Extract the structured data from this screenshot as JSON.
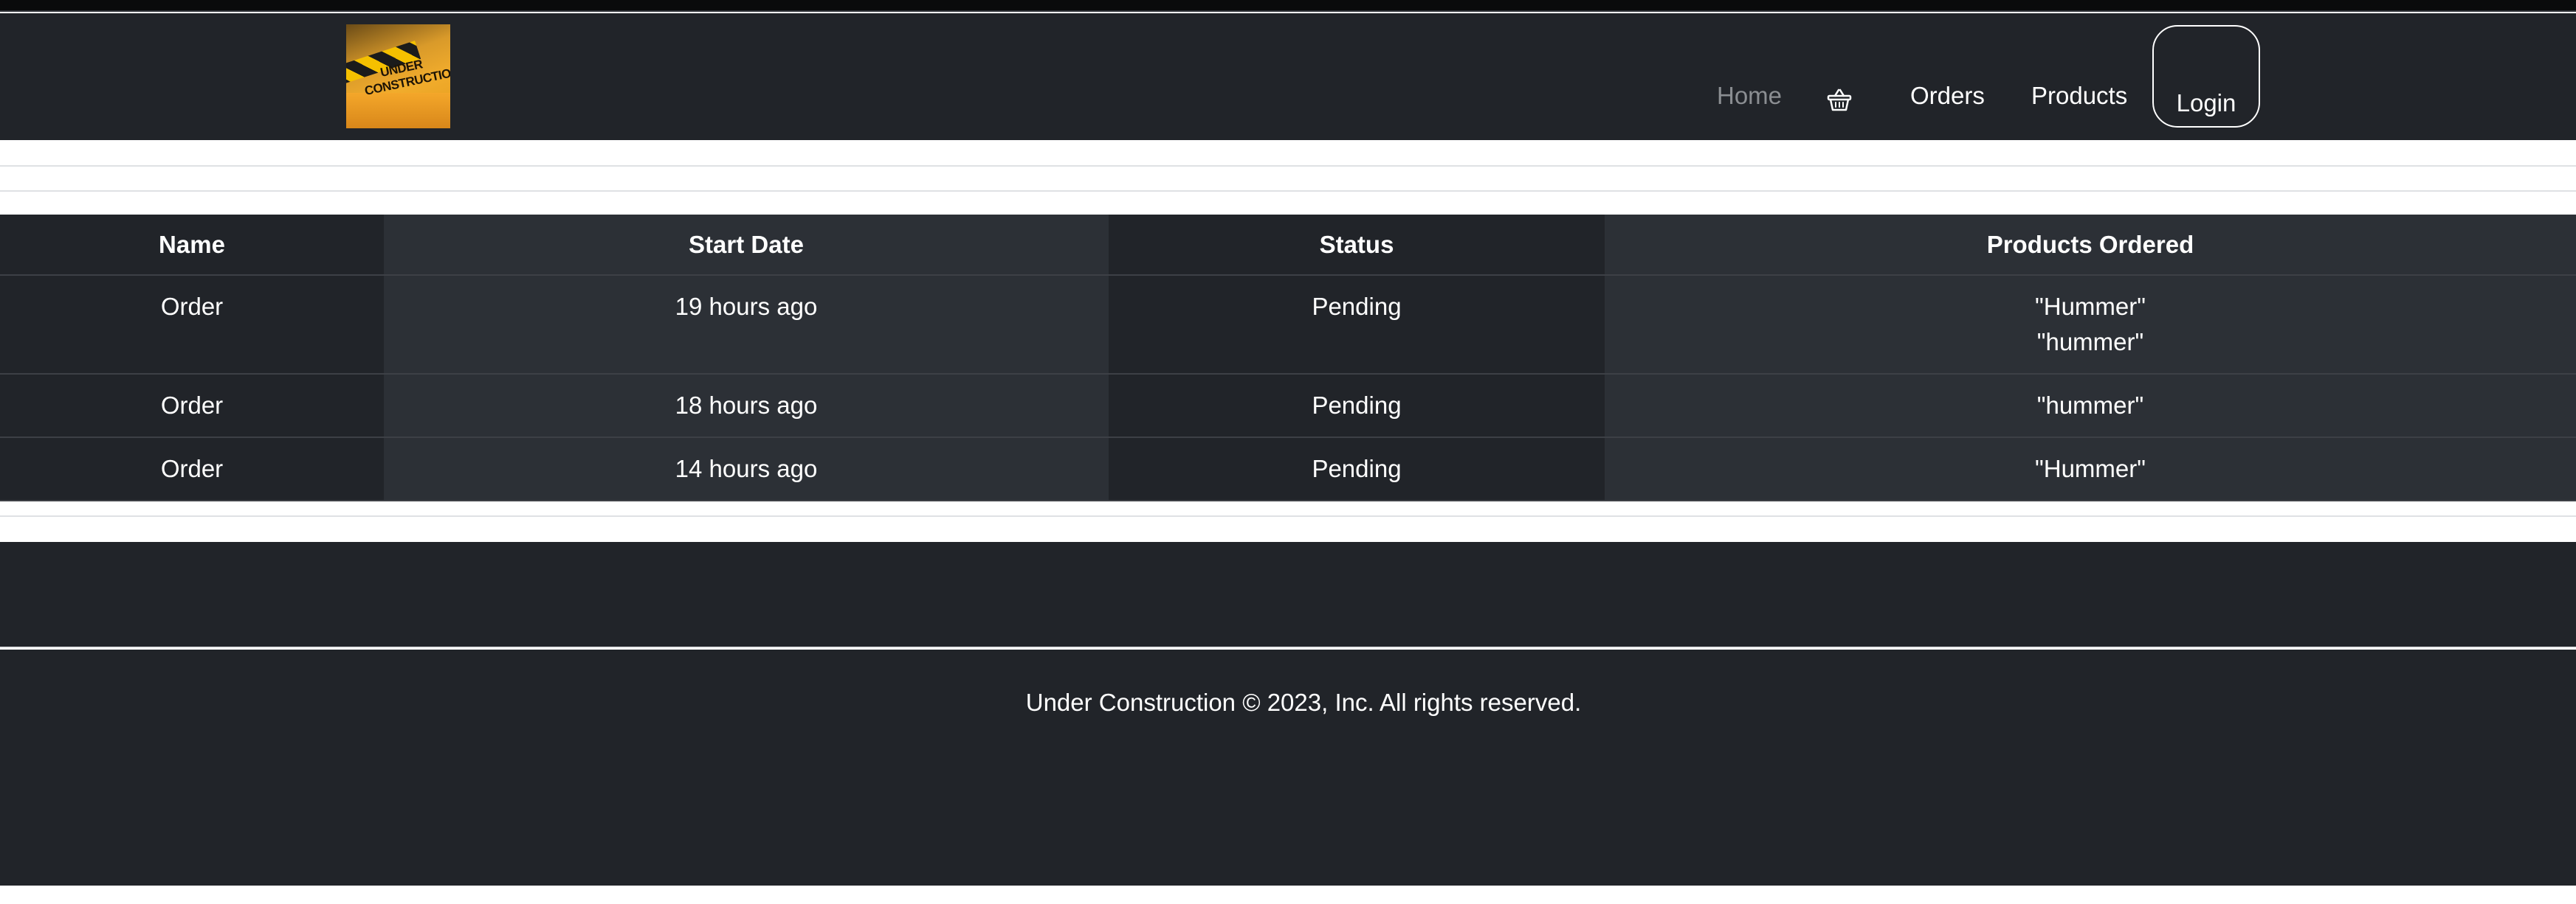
{
  "navbar": {
    "logo_text": "UNDER CONSTRUCTION",
    "links": {
      "home": "Home",
      "orders": "Orders",
      "products": "Products"
    },
    "login_label": "Login",
    "cart_icon": "basket-icon"
  },
  "orders_table": {
    "headers": [
      "Name",
      "Start Date",
      "Status",
      "Products Ordered"
    ],
    "rows": [
      {
        "name": "Order",
        "start_date": "19 hours ago",
        "status": "Pending",
        "products": [
          "\"Hummer\"",
          "\"hummer\""
        ]
      },
      {
        "name": "Order",
        "start_date": "18 hours ago",
        "status": "Pending",
        "products": [
          "\"hummer\""
        ]
      },
      {
        "name": "Order",
        "start_date": "14 hours ago",
        "status": "Pending",
        "products": [
          "\"Hummer\""
        ]
      }
    ]
  },
  "footer": {
    "text": "Under Construction © 2023, Inc. All rights reserved."
  },
  "colors": {
    "navbar_bg": "#212429",
    "table_alt_bg": "#2c3036",
    "muted_link": "#8b8e92"
  }
}
